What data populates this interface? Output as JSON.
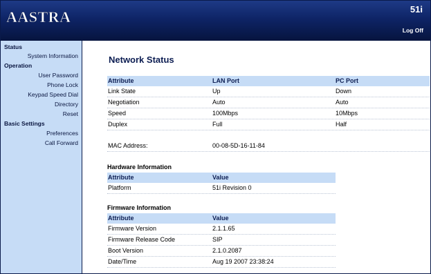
{
  "header": {
    "logo": "AASTRA",
    "model": "51i",
    "logoff": "Log Off"
  },
  "sidebar": {
    "sections": [
      {
        "title": "Status",
        "items": [
          "System Information"
        ]
      },
      {
        "title": "Operation",
        "items": [
          "User Password",
          "Phone Lock",
          "Keypad Speed Dial",
          "Directory",
          "Reset"
        ]
      },
      {
        "title": "Basic Settings",
        "items": [
          "Preferences",
          "Call Forward"
        ]
      }
    ]
  },
  "main": {
    "title": "Network Status",
    "network": {
      "headers": [
        "Attribute",
        "LAN Port",
        "PC Port"
      ],
      "rows": [
        [
          "Link State",
          "Up",
          "Down"
        ],
        [
          "Negotiation",
          "Auto",
          "Auto"
        ],
        [
          "Speed",
          "100Mbps",
          "10Mbps"
        ],
        [
          "Duplex",
          "Full",
          "Half"
        ]
      ],
      "mac_label": "MAC Address:",
      "mac_value": "00-08-5D-16-11-84"
    },
    "hardware": {
      "title": "Hardware Information",
      "headers": [
        "Attribute",
        "Value"
      ],
      "rows": [
        [
          "Platform",
          "51i Revision 0"
        ]
      ]
    },
    "firmware": {
      "title": "Firmware Information",
      "headers": [
        "Attribute",
        "Value"
      ],
      "rows": [
        [
          "Firmware Version",
          "2.1.1.65"
        ],
        [
          "Firmware Release Code",
          "SIP"
        ],
        [
          "Boot Version",
          "2.1.0.2087"
        ],
        [
          "Date/Time",
          "Aug 19 2007 23:38:24"
        ]
      ]
    }
  },
  "colors": {
    "header": "#0e2466",
    "sidebar": "#c6dcf6",
    "title": "#0c1d52"
  }
}
